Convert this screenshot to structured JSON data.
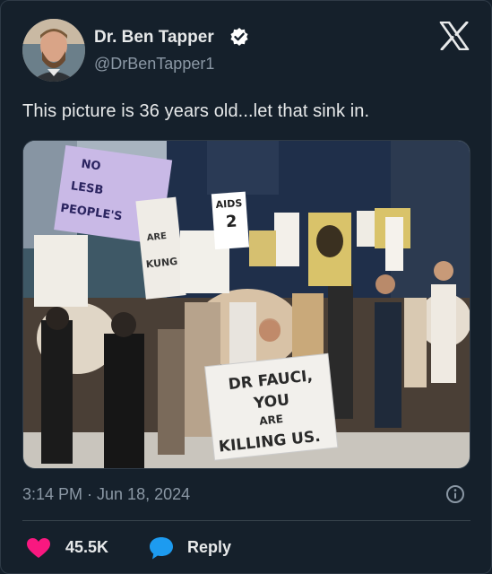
{
  "author": {
    "name": "Dr. Ben Tapper",
    "handle": "@DrBenTapper1"
  },
  "tweet": {
    "text": "This picture is 36 years old...let that sink in.",
    "timestamp": "3:14 PM · Jun 18, 2024"
  },
  "photo_signs": {
    "main_line1": "DR FAUCI,",
    "main_line2": "YOU",
    "main_line3": "ARE",
    "main_line4": "KILLING US.",
    "left_line1": "NO",
    "left_line2": "LESB",
    "left_line3": "PEOPLE'S",
    "middle_line1": "ARE",
    "middle_line2": "KUNG",
    "aids_line1": "AIDS",
    "aids_line2": "2"
  },
  "actions": {
    "like_count": "45.5K",
    "reply_label": "Reply"
  },
  "colors": {
    "background": "#15202b",
    "text_primary": "#e7e9ea",
    "text_secondary": "#8b98a5",
    "verified": "#ffffff",
    "heart": "#f91880",
    "reply_bubble": "#1d9bf0"
  },
  "icons": [
    "verified-badge-icon",
    "x-logo-icon",
    "info-icon",
    "heart-icon",
    "reply-bubble-icon"
  ]
}
